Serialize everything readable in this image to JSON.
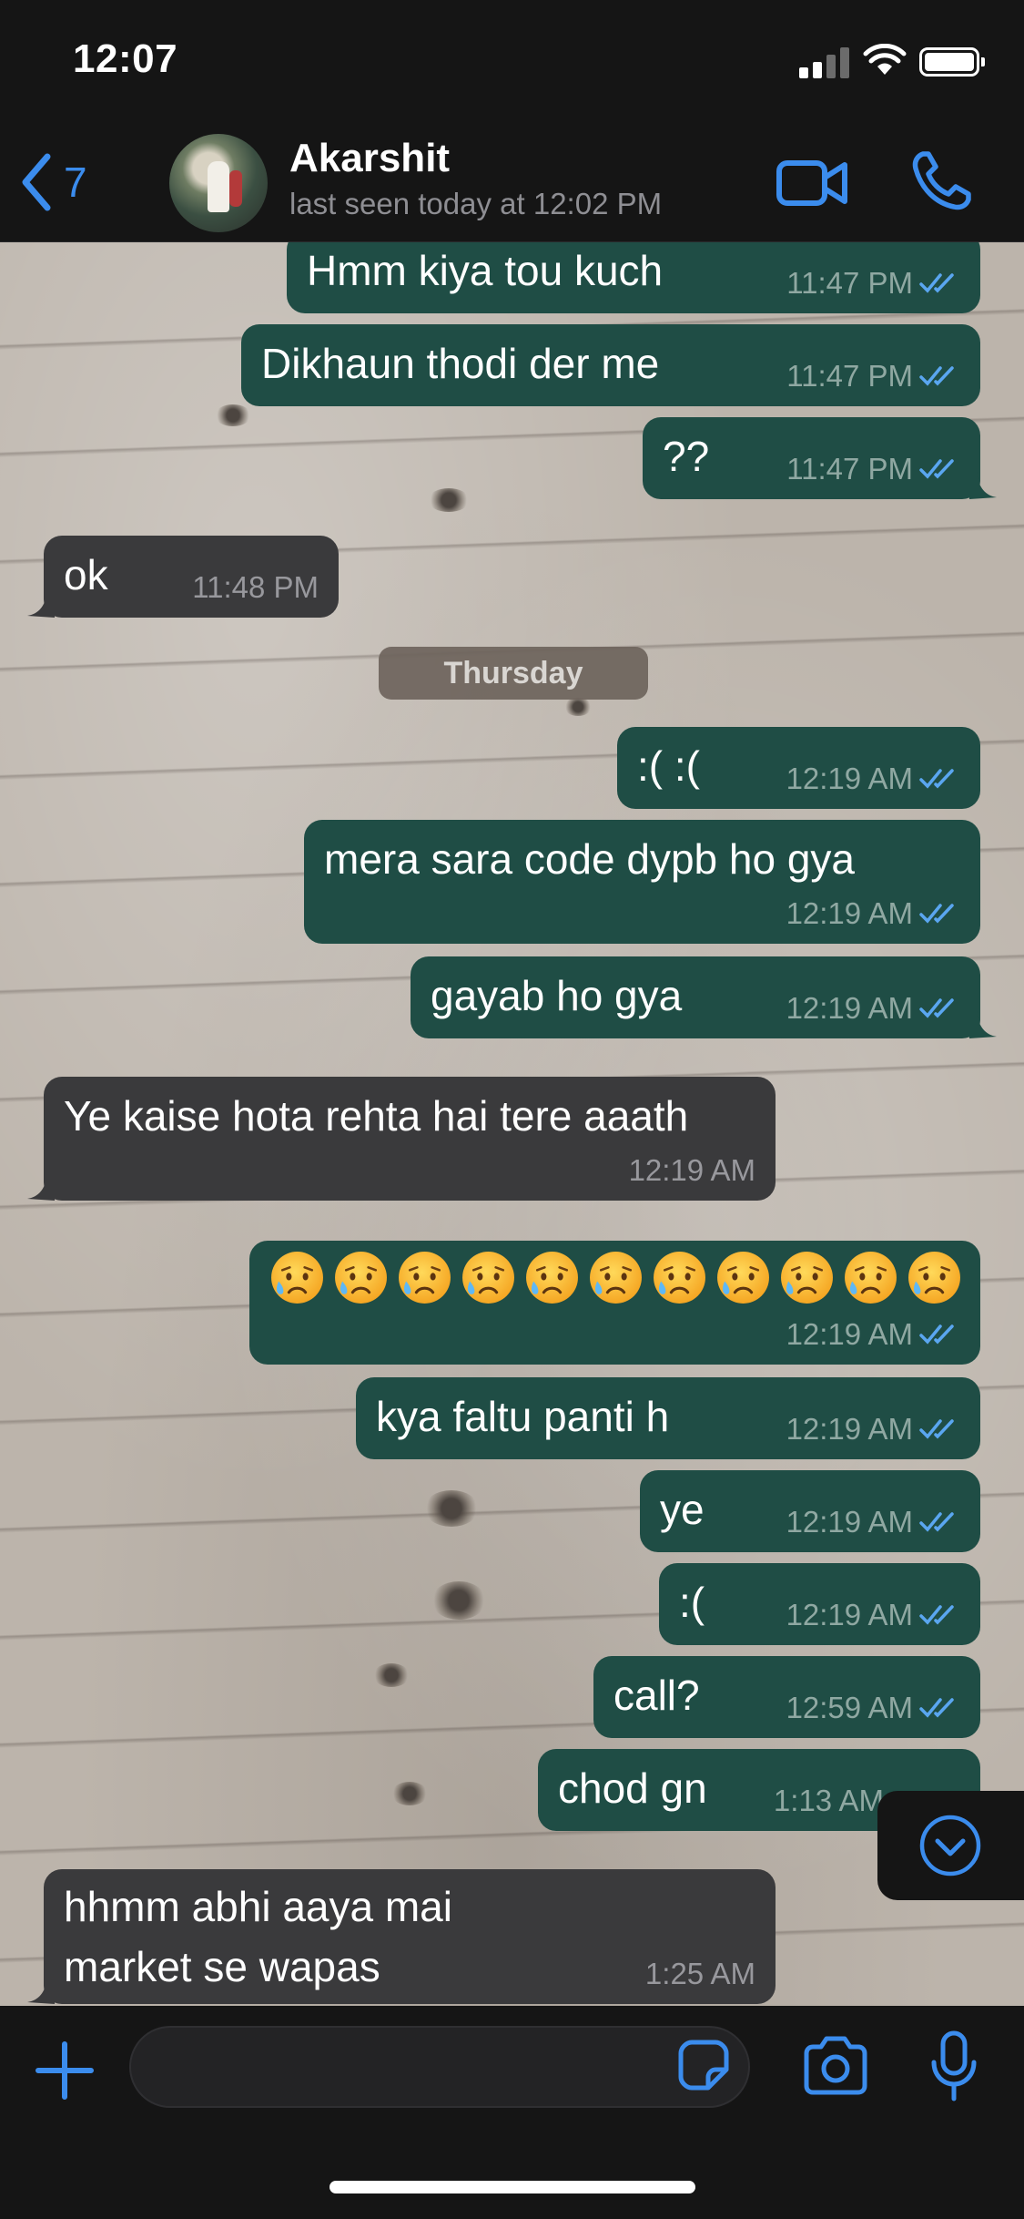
{
  "status_bar": {
    "time": "12:07"
  },
  "nav": {
    "back_count": "7",
    "contact_name": "Akarshit",
    "last_seen": "last seen today at 12:02 PM"
  },
  "day_separator": "Thursday",
  "messages": [
    {
      "dir": "out",
      "text": "Hmm kiya tou kuch",
      "time": "11:47 PM",
      "ticks": "read"
    },
    {
      "dir": "out",
      "text": "Dikhaun thodi der me",
      "time": "11:47 PM",
      "ticks": "read"
    },
    {
      "dir": "out",
      "text": "??",
      "time": "11:47 PM",
      "ticks": "read"
    },
    {
      "dir": "in",
      "text": "ok",
      "time": "11:48 PM"
    },
    {
      "dir": "out",
      "text": ":( :(",
      "time": "12:19 AM",
      "ticks": "read"
    },
    {
      "dir": "out",
      "text": "mera sara code dypb ho gya",
      "time": "12:19 AM",
      "ticks": "read"
    },
    {
      "dir": "out",
      "text": "gayab ho gya",
      "time": "12:19 AM",
      "ticks": "read"
    },
    {
      "dir": "in",
      "text": "Ye kaise hota rehta hai tere aaath",
      "time": "12:19 AM"
    },
    {
      "dir": "out",
      "text": "",
      "emoji": "sad-but-relieved-face",
      "emoji_count": 11,
      "time": "12:19 AM",
      "ticks": "read"
    },
    {
      "dir": "out",
      "text": "kya faltu panti h",
      "time": "12:19 AM",
      "ticks": "read"
    },
    {
      "dir": "out",
      "text": "ye",
      "time": "12:19 AM",
      "ticks": "read"
    },
    {
      "dir": "out",
      "text": ":(",
      "time": "12:19 AM",
      "ticks": "read"
    },
    {
      "dir": "out",
      "text": "call?",
      "time": "12:59 AM",
      "ticks": "read"
    },
    {
      "dir": "out",
      "text": "chod gn",
      "time": "1:13 AM",
      "ticks": "read"
    },
    {
      "dir": "in",
      "text": "hhmm abhi aaya mai market se wapas",
      "time": "1:25 AM"
    }
  ],
  "input": {
    "placeholder": ""
  },
  "colors": {
    "accent": "#3b8ced",
    "outgoing_bubble": "#1f4d45",
    "incoming_bubble": "#3a3a3c",
    "bar_background": "#151515",
    "read_ticks": "#5aa6f0"
  },
  "icons": [
    "chevron-left-icon",
    "video-call-icon",
    "phone-icon",
    "double-check-icon",
    "chevron-down-circle-icon",
    "plus-icon",
    "sticker-icon",
    "camera-icon",
    "microphone-icon",
    "signal-icon",
    "wifi-icon",
    "battery-icon"
  ]
}
